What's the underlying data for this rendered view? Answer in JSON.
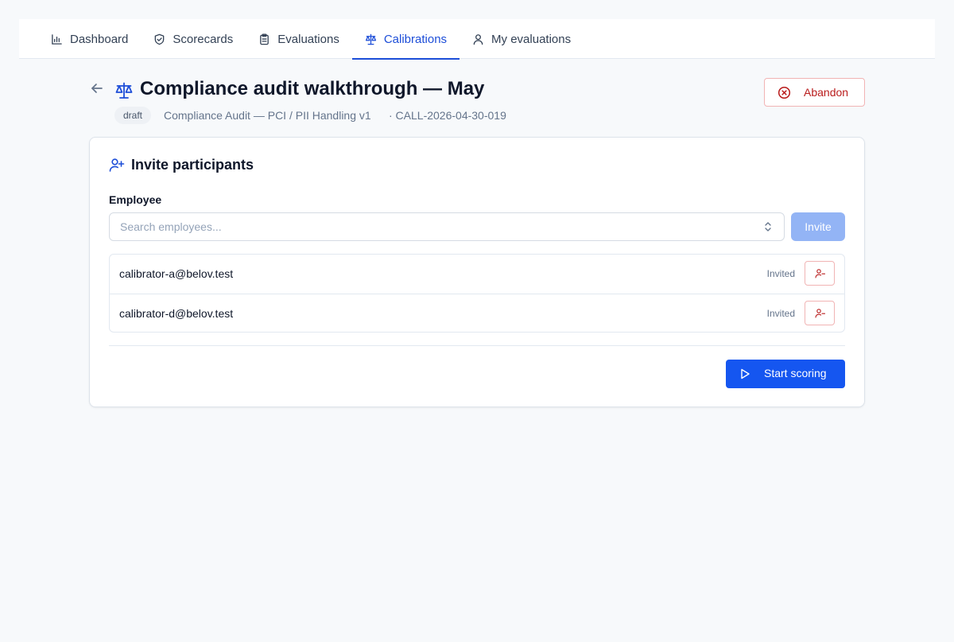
{
  "nav": {
    "tabs": [
      {
        "label": "Dashboard",
        "icon": "bar-chart-icon"
      },
      {
        "label": "Scorecards",
        "icon": "shield-icon"
      },
      {
        "label": "Evaluations",
        "icon": "clipboard-icon"
      },
      {
        "label": "Calibrations",
        "icon": "scale-icon",
        "active": true
      },
      {
        "label": "My evaluations",
        "icon": "user-icon"
      }
    ],
    "active_color": "#1d4ed8"
  },
  "header": {
    "title": "Compliance audit walkthrough — May",
    "status_badge": "draft",
    "scorecard": "Compliance Audit — PCI / PII Handling v1",
    "call_id": "· CALL-2026-04-30-019",
    "abandon_label": "Abandon"
  },
  "card": {
    "title": "Invite participants",
    "field_label": "Employee",
    "search_placeholder": "Search employees...",
    "search_value": "",
    "invite_label": "Invite",
    "participants": [
      {
        "email": "calibrator-a@belov.test",
        "status": "Invited"
      },
      {
        "email": "calibrator-d@belov.test",
        "status": "Invited"
      }
    ],
    "start_label": "Start scoring"
  },
  "colors": {
    "primary": "#1556f0",
    "primary_disabled": "#93b4f5",
    "danger": "#b91c1c",
    "background": "#f7f9fb"
  }
}
